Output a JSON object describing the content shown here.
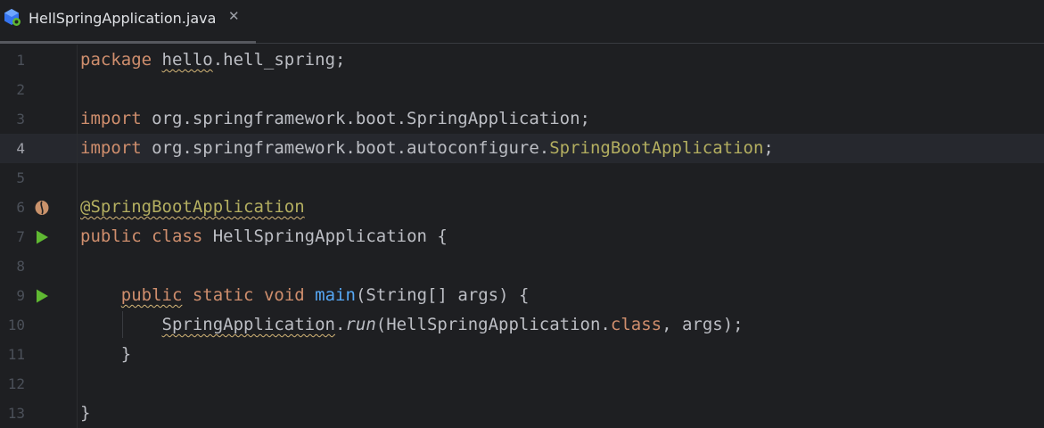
{
  "tab": {
    "title": "HellSpringApplication.java",
    "close_glyph": "✕"
  },
  "colors": {
    "keyword": "#cf8e6d",
    "annotation": "#b3ae60",
    "method": "#56a8f5",
    "text": "#bcbec4",
    "background": "#1e1f22",
    "current_line": "#26282e",
    "run_icon": "#5fb832"
  },
  "gutter_icons": {
    "line6": "spring-bean-icon",
    "line7": "run-icon",
    "line9": "run-icon"
  },
  "editor": {
    "current_line": 4,
    "lines": [
      {
        "n": "1",
        "t": [
          [
            "package",
            "kw"
          ],
          [
            " ",
            "plain"
          ],
          [
            "hello",
            "plain typo"
          ],
          [
            ".hell_spring;",
            "plain"
          ]
        ]
      },
      {
        "n": "2",
        "t": []
      },
      {
        "n": "3",
        "t": [
          [
            "import",
            "kw"
          ],
          [
            " org.springframework.boot.SpringApplication;",
            "plain"
          ]
        ]
      },
      {
        "n": "4",
        "t": [
          [
            "import",
            "kw"
          ],
          [
            " org.springframework.boot.autoconfigure.",
            "plain"
          ],
          [
            "SpringBootApplication",
            "anno"
          ],
          [
            ";",
            "plain"
          ]
        ]
      },
      {
        "n": "5",
        "t": []
      },
      {
        "n": "6",
        "t": [
          [
            "@SpringBootApplication",
            "anno typo"
          ]
        ]
      },
      {
        "n": "7",
        "t": [
          [
            "public",
            "kw"
          ],
          [
            " ",
            "plain"
          ],
          [
            "class",
            "kw"
          ],
          [
            " HellSpringApplication {",
            "plain"
          ]
        ]
      },
      {
        "n": "8",
        "t": []
      },
      {
        "n": "9",
        "t": [
          [
            "    ",
            "plain"
          ],
          [
            "public",
            "kw typo"
          ],
          [
            " ",
            "plain"
          ],
          [
            "static",
            "kw"
          ],
          [
            " ",
            "plain"
          ],
          [
            "void",
            "kw"
          ],
          [
            " ",
            "plain"
          ],
          [
            "main",
            "fn"
          ],
          [
            "(String[] args) {",
            "plain"
          ]
        ]
      },
      {
        "n": "10",
        "t": [
          [
            "        ",
            "plain"
          ],
          [
            "SpringApplication",
            "plain typo"
          ],
          [
            ".",
            "plain"
          ],
          [
            "run",
            "plain it"
          ],
          [
            "(HellSpringApplication.",
            "plain"
          ],
          [
            "class",
            "kw"
          ],
          [
            ", args);",
            "plain"
          ]
        ]
      },
      {
        "n": "11",
        "t": [
          [
            "    }",
            "plain"
          ]
        ]
      },
      {
        "n": "12",
        "t": []
      },
      {
        "n": "13",
        "t": [
          [
            "}",
            "plain"
          ]
        ]
      }
    ]
  }
}
